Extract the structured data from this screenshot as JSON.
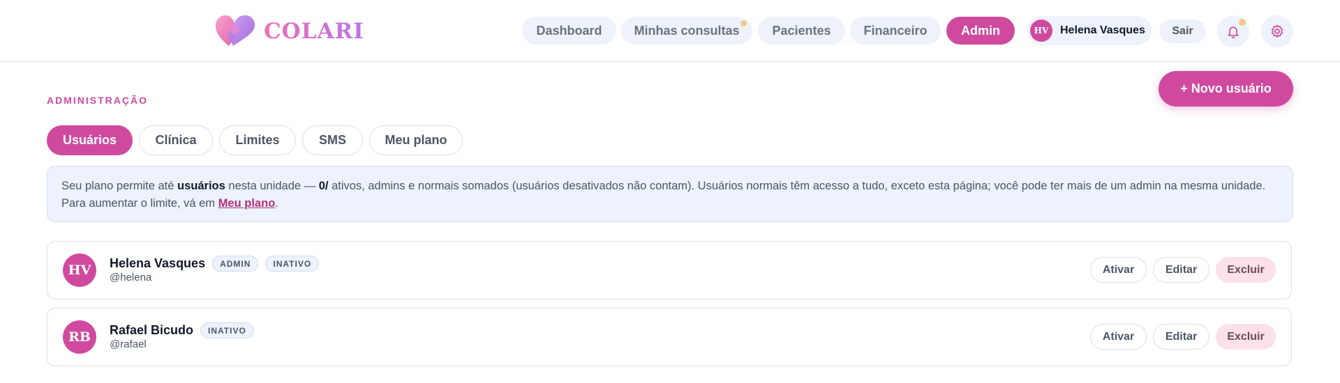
{
  "brand": {
    "name": "COLARI",
    "icon": "heart-logo-icon",
    "gradient": [
      "#ef6fb0",
      "#b776e6"
    ]
  },
  "nav": {
    "items": [
      {
        "label": "Dashboard",
        "active": false
      },
      {
        "label": "Minhas consultas",
        "active": false,
        "has_dot": true
      },
      {
        "label": "Pacientes",
        "active": false
      },
      {
        "label": "Financeiro",
        "active": false
      },
      {
        "label": "Admin",
        "active": true
      }
    ]
  },
  "user": {
    "initials": "HV",
    "name": "Helena Vasques"
  },
  "header_actions": {
    "logout_label": "Sair",
    "notification_icon": "bell-icon",
    "settings_icon": "gear-icon"
  },
  "admin": {
    "section_label": "ADMINISTRAÇÃO",
    "new_user_label": "+ Novo usuário",
    "tabs": [
      {
        "label": "Usuários",
        "active": true
      },
      {
        "label": "Clínica",
        "active": false
      },
      {
        "label": "Limites",
        "active": false
      },
      {
        "label": "SMS",
        "active": false
      },
      {
        "label": "Meu plano",
        "active": false
      }
    ],
    "info": {
      "part1": "Seu plano permite até ",
      "bold1": "usuários",
      "part2": " nesta unidade — ",
      "bold2": "0/",
      "part3": " ativos, admins e normais somados (usuários desativados não contam). Usuários normais têm acesso a tudo, exceto esta página; você pode ter mais de um admin na mesma unidade. Para aumentar o limite, vá em ",
      "link": "Meu plano",
      "part4": "."
    },
    "users": [
      {
        "initials": "HV",
        "name": "Helena Vasques",
        "handle": "@helena",
        "badges": [
          "ADMIN",
          "INATIVO"
        ]
      },
      {
        "initials": "RB",
        "name": "Rafael Bicudo",
        "handle": "@rafael",
        "badges": [
          "INATIVO"
        ]
      }
    ],
    "actions": {
      "activate": "Ativar",
      "edit": "Editar",
      "delete": "Excluir"
    }
  },
  "colors": {
    "accent": "#cf4a9f",
    "pill_bg": "#eef2fb",
    "danger_bg": "#fbe1ea"
  }
}
